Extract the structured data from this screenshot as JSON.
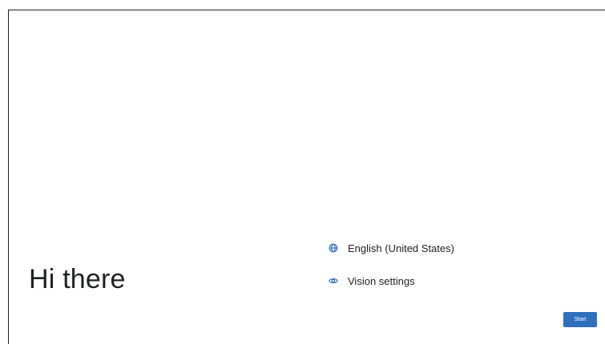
{
  "welcome": {
    "greeting": "Hi there"
  },
  "options": {
    "language": {
      "label": "English (United States)",
      "icon": "globe-icon"
    },
    "vision": {
      "label": "Vision settings",
      "icon": "eye-icon"
    }
  },
  "actions": {
    "start_label": "Start"
  },
  "colors": {
    "accent": "#2f6fbe",
    "icon": "#2f6fbe",
    "text": "#202124",
    "background": "#ffffff"
  }
}
